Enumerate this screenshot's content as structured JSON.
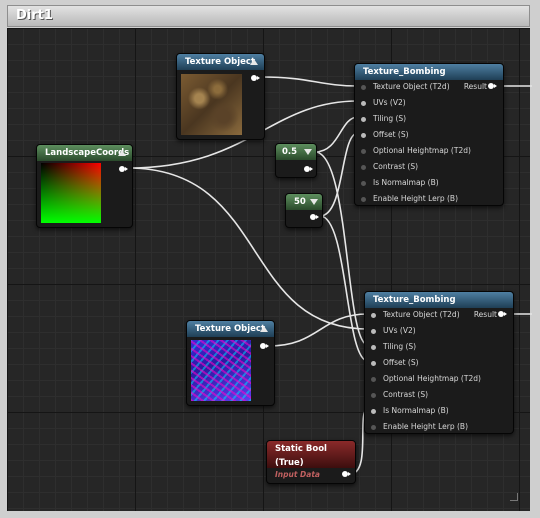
{
  "window": {
    "title": "Dirt1"
  },
  "nodes": {
    "tex1": {
      "title": "Texture Object"
    },
    "tex2": {
      "title": "Texture Object"
    },
    "coords": {
      "title": "LandscapeCoords"
    },
    "const1": {
      "title": "0.5"
    },
    "const2": {
      "title": "50"
    },
    "staticbool": {
      "title": "Static Bool (True)",
      "subtitle": "Input Data"
    },
    "bomb1": {
      "title": "Texture_Bombing",
      "output": "Result",
      "inputs": [
        "Texture Object (T2d)",
        "UVs (V2)",
        "Tiling (S)",
        "Offset (S)",
        "Optional Heightmap (T2d)",
        "Contrast (S)",
        "Is Normalmap (B)",
        "Enable Height Lerp (B)"
      ]
    },
    "bomb2": {
      "title": "Texture_Bombing",
      "output": "Result",
      "inputs": [
        "Texture Object (T2d)",
        "UVs (V2)",
        "Tiling (S)",
        "Offset (S)",
        "Optional Heightmap (T2d)",
        "Contrast (S)",
        "Is Normalmap (B)",
        "Enable Height Lerp (B)"
      ]
    }
  }
}
